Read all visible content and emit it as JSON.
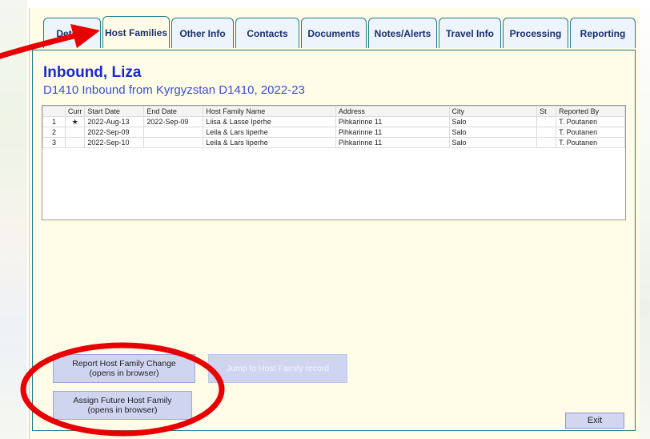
{
  "tabs": [
    {
      "label": "Details",
      "active": false
    },
    {
      "label": "Host Families",
      "active": true
    },
    {
      "label": "Other Info",
      "active": false
    },
    {
      "label": "Contacts",
      "active": false
    },
    {
      "label": "Documents",
      "active": false
    },
    {
      "label": "Notes/Alerts",
      "active": false
    },
    {
      "label": "Travel Info",
      "active": false
    },
    {
      "label": "Processing",
      "active": false
    },
    {
      "label": "Reporting",
      "active": false
    }
  ],
  "student": {
    "name": "Inbound, Liza",
    "subtitle": "D1410 Inbound from Kyrgyzstan D1410, 2022-23"
  },
  "table": {
    "headers": [
      "",
      "Curr",
      "Start Date",
      "End Date",
      "Host Family Name",
      "Address",
      "City",
      "St",
      "Reported By"
    ],
    "rows": [
      [
        "1",
        "★",
        "2022-Aug-13",
        "2022-Sep-09",
        "Liisa & Lasse Iperhe",
        "Pihkarinne 11",
        "Salo",
        "",
        "T. Poutanen"
      ],
      [
        "2",
        "",
        "2022-Sep-09",
        "",
        "Leila & Lars Iiperhe",
        "Pihkarinne 11",
        "Salo",
        "",
        "T. Poutanen"
      ],
      [
        "3",
        "",
        "2022-Sep-10",
        "",
        "Leila & Lars Iiperhe",
        "Pihkarinne 11",
        "Salo",
        "",
        "T. Poutanen"
      ]
    ]
  },
  "buttons": {
    "report_change_line1": "Report Host Family Change",
    "report_change_line2": "(opens in browser)",
    "jump_record": "Jump to Host Family record",
    "assign_future_line1": "Assign Future Host Family",
    "assign_future_line2": "(opens in browser)",
    "exit": "Exit"
  },
  "colors": {
    "annotation": "#e80000",
    "tab_border": "#1f7b8a",
    "panel_background": "#fffce8",
    "button_fill": "#cfd4f1",
    "name_blue": "#1a2ad0"
  },
  "annotations": {
    "arrow": "red-arrow-pointing-to-host-families-tab",
    "ellipse": "red-ellipse-around-host-family-buttons"
  }
}
